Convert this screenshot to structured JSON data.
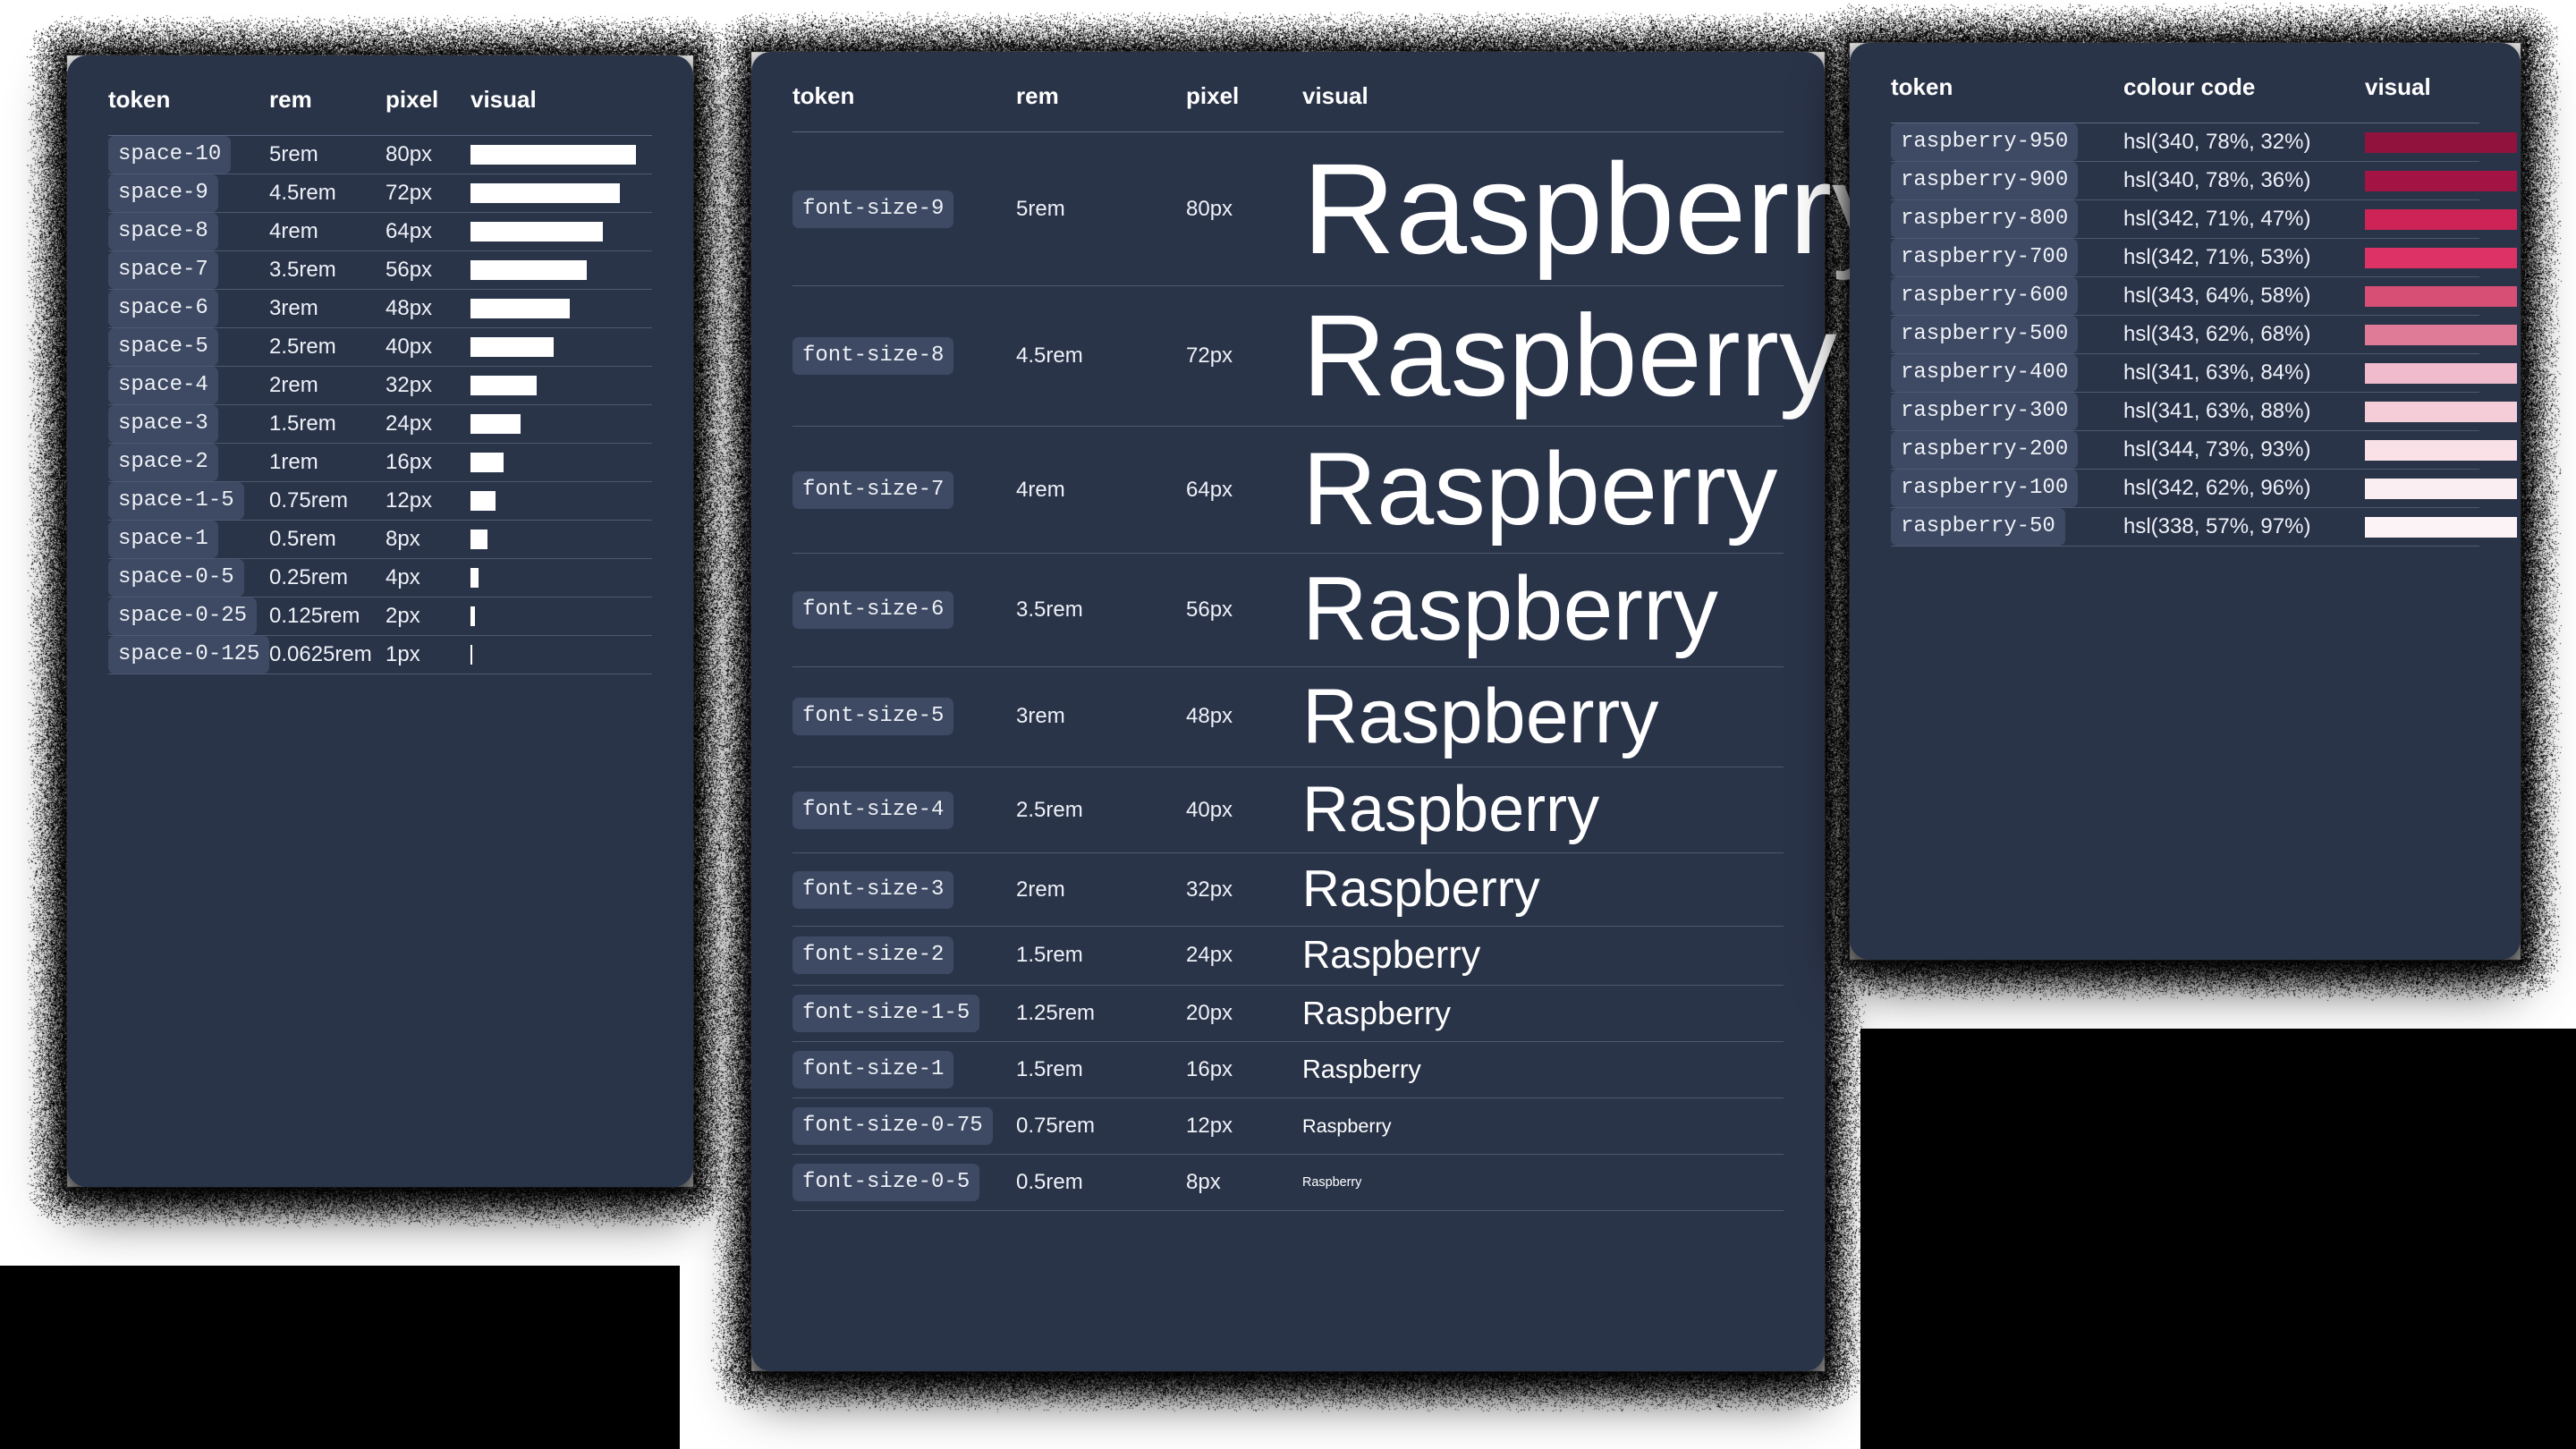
{
  "cards": [
    {
      "id": "space",
      "name": "spacing-tokens-card",
      "columns": [
        "token",
        "rem",
        "pixel",
        "visual"
      ],
      "rows": [
        {
          "token": "space-10",
          "rem": "5rem",
          "pixel": "80px",
          "px": 80
        },
        {
          "token": "space-9",
          "rem": "4.5rem",
          "pixel": "72px",
          "px": 72
        },
        {
          "token": "space-8",
          "rem": "4rem",
          "pixel": "64px",
          "px": 64
        },
        {
          "token": "space-7",
          "rem": "3.5rem",
          "pixel": "56px",
          "px": 56
        },
        {
          "token": "space-6",
          "rem": "3rem",
          "pixel": "48px",
          "px": 48
        },
        {
          "token": "space-5",
          "rem": "2.5rem",
          "pixel": "40px",
          "px": 40
        },
        {
          "token": "space-4",
          "rem": "2rem",
          "pixel": "32px",
          "px": 32
        },
        {
          "token": "space-3",
          "rem": "1.5rem",
          "pixel": "24px",
          "px": 24
        },
        {
          "token": "space-2",
          "rem": "1rem",
          "pixel": "16px",
          "px": 16
        },
        {
          "token": "space-1-5",
          "rem": "0.75rem",
          "pixel": "12px",
          "px": 12
        },
        {
          "token": "space-1",
          "rem": "0.5rem",
          "pixel": "8px",
          "px": 8
        },
        {
          "token": "space-0-5",
          "rem": "0.25rem",
          "pixel": "4px",
          "px": 4
        },
        {
          "token": "space-0-25",
          "rem": "0.125rem",
          "pixel": "2px",
          "px": 2
        },
        {
          "token": "space-0-125",
          "rem": "0.0625rem",
          "pixel": "1px",
          "px": 1
        }
      ]
    },
    {
      "id": "font",
      "name": "font-size-tokens-card",
      "columns": [
        "token",
        "rem",
        "pixel",
        "visual"
      ],
      "sample_word": "Raspberry",
      "rows": [
        {
          "token": "font-size-9",
          "rem": "5rem",
          "pixel": "80px",
          "px": 80
        },
        {
          "token": "font-size-8",
          "rem": "4.5rem",
          "pixel": "72px",
          "px": 72
        },
        {
          "token": "font-size-7",
          "rem": "4rem",
          "pixel": "64px",
          "px": 64
        },
        {
          "token": "font-size-6",
          "rem": "3.5rem",
          "pixel": "56px",
          "px": 56
        },
        {
          "token": "font-size-5",
          "rem": "3rem",
          "pixel": "48px",
          "px": 48
        },
        {
          "token": "font-size-4",
          "rem": "2.5rem",
          "pixel": "40px",
          "px": 40
        },
        {
          "token": "font-size-3",
          "rem": "2rem",
          "pixel": "32px",
          "px": 32
        },
        {
          "token": "font-size-2",
          "rem": "1.5rem",
          "pixel": "24px",
          "px": 24
        },
        {
          "token": "font-size-1-5",
          "rem": "1.25rem",
          "pixel": "20px",
          "px": 20
        },
        {
          "token": "font-size-1",
          "rem": "1.5rem",
          "pixel": "16px",
          "px": 16
        },
        {
          "token": "font-size-0-75",
          "rem": "0.75rem",
          "pixel": "12px",
          "px": 12
        },
        {
          "token": "font-size-0-5",
          "rem": "0.5rem",
          "pixel": "8px",
          "px": 8
        }
      ]
    },
    {
      "id": "colour",
      "name": "colour-tokens-card",
      "columns": [
        "token",
        "colour code",
        "visual"
      ],
      "rows": [
        {
          "token": "raspberry-950",
          "code": "hsl(340, 78%, 32%)",
          "hex": "hsl(340, 78%, 32%)"
        },
        {
          "token": "raspberry-900",
          "code": "hsl(340, 78%, 36%)",
          "hex": "hsl(340, 78%, 36%)"
        },
        {
          "token": "raspberry-800",
          "code": "hsl(342, 71%, 47%)",
          "hex": "hsl(342, 71%, 47%)"
        },
        {
          "token": "raspberry-700",
          "code": "hsl(342, 71%, 53%)",
          "hex": "hsl(342, 71%, 53%)"
        },
        {
          "token": "raspberry-600",
          "code": "hsl(343, 64%, 58%)",
          "hex": "hsl(343, 64%, 58%)"
        },
        {
          "token": "raspberry-500",
          "code": "hsl(343, 62%, 68%)",
          "hex": "hsl(343, 62%, 68%)"
        },
        {
          "token": "raspberry-400",
          "code": "hsl(341, 63%, 84%)",
          "hex": "hsl(341, 63%, 84%)"
        },
        {
          "token": "raspberry-300",
          "code": "hsl(341, 63%, 88%)",
          "hex": "hsl(341, 63%, 88%)"
        },
        {
          "token": "raspberry-200",
          "code": "hsl(344, 73%, 93%)",
          "hex": "hsl(344, 73%, 93%)"
        },
        {
          "token": "raspberry-100",
          "code": "hsl(342, 62%, 96%)",
          "hex": "hsl(342, 62%, 96%)"
        },
        {
          "token": "raspberry-50",
          "code": "hsl(338, 57%, 97%)",
          "hex": "hsl(338, 57%, 97%)"
        }
      ]
    }
  ],
  "theme": {
    "card_background": "#2a3449",
    "badge_background": "#3e4a63",
    "text_colour": "#eef1f7",
    "divider_colour": "#4d586f",
    "page_background": "#000000",
    "sheet_background": "#ffffff"
  }
}
